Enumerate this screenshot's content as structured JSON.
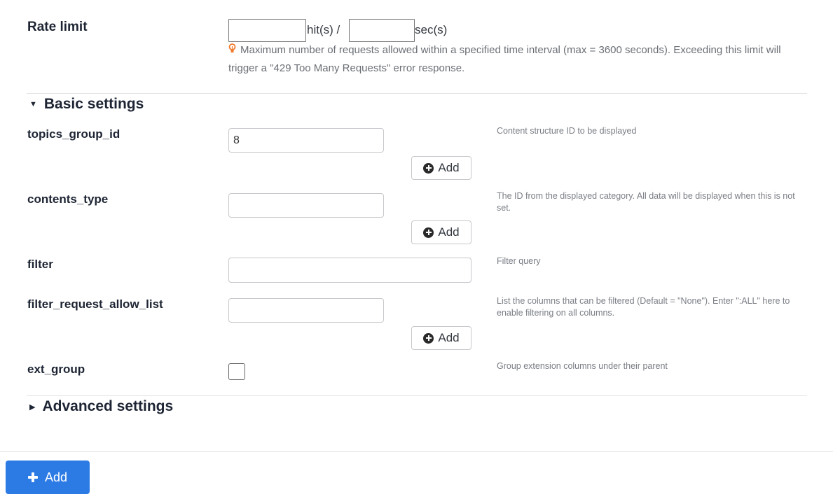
{
  "rate_limit": {
    "label": "Rate limit",
    "hits_value": "",
    "hits_unit": "hit(s) /",
    "seconds_value": "",
    "seconds_unit": "sec(s)",
    "hint_icon": "lightbulb-icon",
    "hint": "Maximum number of requests allowed within a specified time interval (max = 3600 seconds). Exceeding this limit will trigger a \"429 Too Many Requests\" error response."
  },
  "basic_settings": {
    "title": "Basic settings",
    "expanded": true,
    "fields": [
      {
        "name": "topics_group_id",
        "value": "8",
        "add_label": "Add",
        "help": "Content structure ID to be displayed"
      },
      {
        "name": "contents_type",
        "value": "",
        "add_label": "Add",
        "help": "The ID from the displayed category. All data will be displayed when this is not set."
      },
      {
        "name": "filter",
        "value": "",
        "help": "Filter query"
      },
      {
        "name": "filter_request_allow_list",
        "value": "",
        "add_label": "Add",
        "help": "List the columns that can be filtered (Default = \"None\"). Enter \":ALL\" here to enable filtering on all columns."
      },
      {
        "name": "ext_group",
        "checked": false,
        "help": "Group extension columns under their parent"
      }
    ]
  },
  "advanced_settings": {
    "title": "Advanced settings",
    "expanded": false
  },
  "footer": {
    "add_button_label": "Add",
    "accent_color": "#2c7be5"
  }
}
